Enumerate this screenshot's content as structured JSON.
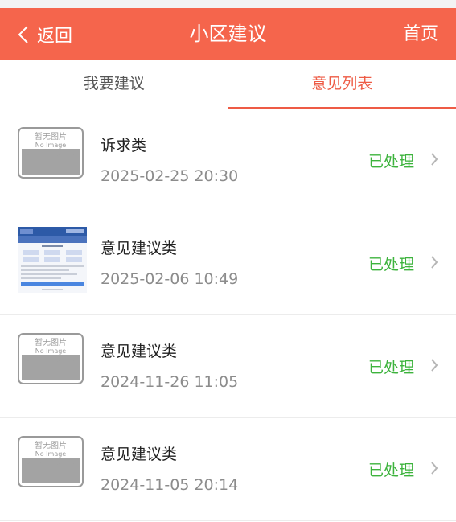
{
  "header": {
    "back_label": "返回",
    "title": "小区建议",
    "home_label": "首页",
    "bg_color": "#f5654c"
  },
  "tabs": [
    {
      "label": "我要建议",
      "active": false
    },
    {
      "label": "意见列表",
      "active": true
    }
  ],
  "placeholder_image": {
    "line1": "暂无图片",
    "line2": "No Image"
  },
  "list": [
    {
      "title": "诉求类",
      "time": "2025-02-25 20:30",
      "status": "已处理",
      "image": "no-image"
    },
    {
      "title": "意见建议类",
      "time": "2025-02-06 10:49",
      "status": "已处理",
      "image": "screenshot"
    },
    {
      "title": "意见建议类",
      "time": "2024-11-26 11:05",
      "status": "已处理",
      "image": "no-image"
    },
    {
      "title": "意见建议类",
      "time": "2024-11-05 20:14",
      "status": "已处理",
      "image": "no-image"
    }
  ],
  "colors": {
    "accent": "#ee5b45",
    "status_done": "#3db33d"
  },
  "icons": [
    "chevron-left-icon",
    "chevron-right-icon",
    "no-image-icon"
  ]
}
